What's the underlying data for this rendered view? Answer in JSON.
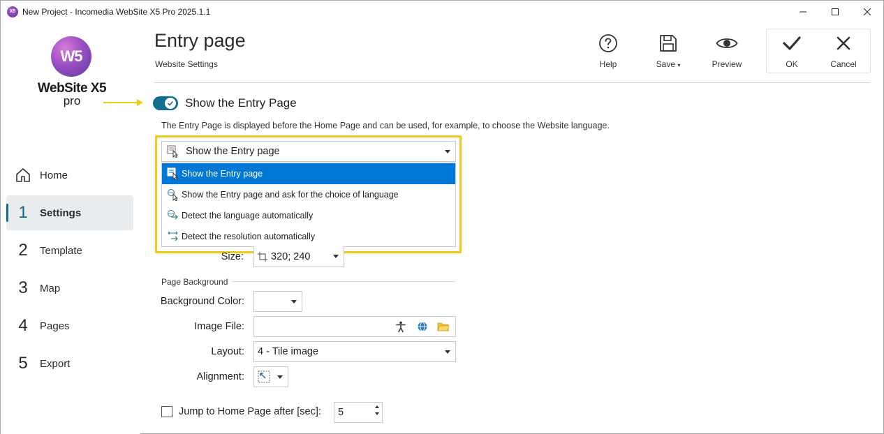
{
  "window": {
    "title": "New Project - Incomedia WebSite X5 Pro 2025.1.1",
    "controls": [
      "minimize",
      "maximize",
      "close"
    ]
  },
  "logo": {
    "mark": "W5",
    "name": "WebSite X5",
    "edition": "pro"
  },
  "sidebar": {
    "items": [
      {
        "num": "",
        "label": "Home",
        "icon": "home-icon",
        "active": false
      },
      {
        "num": "1",
        "label": "Settings",
        "active": true
      },
      {
        "num": "2",
        "label": "Template",
        "active": false
      },
      {
        "num": "3",
        "label": "Map",
        "active": false
      },
      {
        "num": "4",
        "label": "Pages",
        "active": false
      },
      {
        "num": "5",
        "label": "Export",
        "active": false
      }
    ]
  },
  "header": {
    "title": "Entry page",
    "subtitle": "Website Settings"
  },
  "toolbar": {
    "help_label": "Help",
    "save_label": "Save",
    "preview_label": "Preview",
    "ok_label": "OK",
    "cancel_label": "Cancel"
  },
  "entry": {
    "toggle_label": "Show the Entry Page",
    "toggle_on": true,
    "description": "The Entry Page is displayed before the Home Page and can be used, for example, to choose the Website language.",
    "mode_selected": "Show the Entry page",
    "mode_options": [
      {
        "label": "Show the Entry page",
        "icon": "entry-page-icon",
        "selected": true
      },
      {
        "label": "Show the Entry page and ask for the choice of language",
        "icon": "language-choice-icon",
        "selected": false
      },
      {
        "label": "Detect the language automatically",
        "icon": "language-detect-icon",
        "selected": false
      },
      {
        "label": "Detect the resolution automatically",
        "icon": "resolution-detect-icon",
        "selected": false
      }
    ]
  },
  "form": {
    "size_label": "Size:",
    "size_value": "320; 240",
    "section_background": "Page Background",
    "bg_color_label": "Background Color:",
    "image_file_label": "Image File:",
    "image_file_value": "",
    "layout_label": "Layout:",
    "layout_value": "4 - Tile image",
    "alignment_label": "Alignment:",
    "jump_label": "Jump to Home Page after [sec]:",
    "jump_checked": false,
    "jump_value": "5"
  },
  "colors": {
    "accent": "#0e6b8c",
    "selection": "#0078d7",
    "highlight": "#f2c81b",
    "toggle": "#10708e"
  }
}
